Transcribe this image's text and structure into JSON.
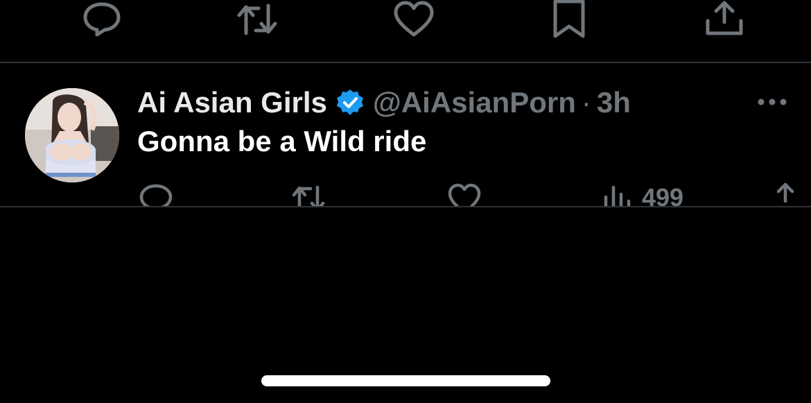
{
  "colors": {
    "background": "#000000",
    "divider": "#2f3336",
    "icon_gray": "#71767b",
    "text_primary": "#e7e9ea",
    "verified_blue": "#1d9bf0"
  },
  "top_actions": {
    "icons": [
      "reply-icon",
      "retweet-icon",
      "like-icon",
      "bookmark-icon",
      "share-icon"
    ]
  },
  "tweet": {
    "display_name": "Ai Asian Girls",
    "verified_icon": "verified-badge-icon",
    "handle": "@AiAsianPorn",
    "separator": "·",
    "time": "3h",
    "text": "Gonna be a Wild ride",
    "more_icon": "more-options-icon",
    "views_count": "499",
    "action_icons": [
      "reply-icon",
      "retweet-icon",
      "like-icon",
      "views-icon",
      "share-icon"
    ]
  }
}
